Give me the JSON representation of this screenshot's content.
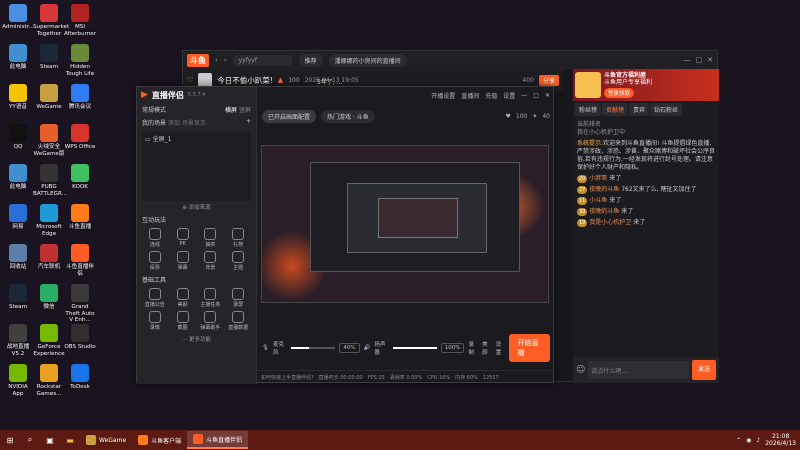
{
  "desktop": {
    "icons": [
      {
        "label": "Administr...",
        "color": "#4a90e2"
      },
      {
        "label": "Supermarket Together",
        "color": "#d9383a"
      },
      {
        "label": "MSI Afterburner",
        "color": "#b22222"
      },
      {
        "label": "此电脑",
        "color": "#3e8ed0"
      },
      {
        "label": "Steam",
        "color": "#1b2838"
      },
      {
        "label": "Hidden Tough Life",
        "color": "#6a8a3a"
      },
      {
        "label": "YY语音",
        "color": "#f5c400"
      },
      {
        "label": "WeGame",
        "color": "#c8a040"
      },
      {
        "label": "腾讯会议",
        "color": "#2f7cf6"
      },
      {
        "label": "QQ",
        "color": "#111111"
      },
      {
        "label": "火绒安全 WeGame版",
        "color": "#e65f2b"
      },
      {
        "label": "WPS Office",
        "color": "#d8342c"
      },
      {
        "label": "此电脑",
        "color": "#3e8ed0"
      },
      {
        "label": "PUBG BATTLEGR...",
        "color": "#333333"
      },
      {
        "label": "KOOK",
        "color": "#40c060"
      },
      {
        "label": "网易",
        "color": "#2a6fd8"
      },
      {
        "label": "Microsoft Edge",
        "color": "#1f9ad6"
      },
      {
        "label": "斗鱼直播",
        "color": "#ff7b1a"
      },
      {
        "label": "回收站",
        "color": "#5a7fa8"
      },
      {
        "label": "汽车联机",
        "color": "#c03030"
      },
      {
        "label": "斗鱼直播伴侣",
        "color": "#ff5d23"
      },
      {
        "label": "Steam",
        "color": "#1b2838"
      },
      {
        "label": "微信",
        "color": "#2aae67"
      },
      {
        "label": "Grand Theft Auto V Enh...",
        "color": "#3a3a3a"
      },
      {
        "label": "战地直播 V5.2",
        "color": "#404040"
      },
      {
        "label": "GeForce Experience",
        "color": "#76b900"
      },
      {
        "label": "OBS Studio",
        "color": "#302e31"
      },
      {
        "label": "NVIDIA App",
        "color": "#76b900"
      },
      {
        "label": "Rockstar Games...",
        "color": "#e8a020"
      },
      {
        "label": "ToDesk",
        "color": "#1a73e8"
      }
    ]
  },
  "client": {
    "logo": "斗鱼",
    "search_value": "yyfyyf",
    "tab1": "推荐",
    "tab2": "潘娜娜的小房间的直播间",
    "room_title": "今日不偷小趴菜!",
    "room_views": "100",
    "room_date": "2026-04-13 19:05",
    "follow_count": "400",
    "share_label": "分享",
    "promo_title": "斗鱼官方福利屋",
    "promo_sub": "斗鱼用户专享福利",
    "promo_btn": "登录领取",
    "rp_tabs": [
      "粉丝榜",
      "贡献榜",
      "贵宾",
      "钻石粉丝"
    ],
    "rp_active": "贡献榜",
    "rank_label": "当前排名",
    "rank_text": "我在小心机护卫中",
    "sys_label": "系统提示:",
    "sys_text": "欢迎来到斗鱼直播间! 斗鱼提倡绿色直播,严禁涉政、涉恐、涉黄、聚众赌博和破坏社会公序良俗,若有违规行为,一经发现将进行封号处理。请注意保护好个人财产和隐私。",
    "msgs": [
      {
        "lv": "20",
        "name": "小胖哥",
        "text": "来了"
      },
      {
        "lv": "27",
        "name": "夜晚的斗鱼",
        "text": "762又来了么, 瞎扯又加住了"
      },
      {
        "lv": "11",
        "name": "小斗鱼",
        "text": "来了"
      },
      {
        "lv": "30",
        "name": "夜晚的斗鱼",
        "text": "来了"
      },
      {
        "lv": "19",
        "name": "我是小心机护卫",
        "text": "来了"
      }
    ],
    "input_placeholder": "说点什么吧...",
    "send_label": "发送"
  },
  "live": {
    "logo": "直播伴侣",
    "version": "5.5.7.4",
    "mode": "常规模式",
    "mode_right1": "横屏",
    "mode_right2": "竖屏",
    "scene_label": "我的场景",
    "scene_tab2": "添加",
    "scene_tab3": "场景显示",
    "scene_item": "全屏_1",
    "add_source": "添加来源",
    "title_hint": "5年了, ...",
    "top_btns": [
      "开播设置",
      "直播间",
      "充值",
      "设置"
    ],
    "category": "已开启画面配置",
    "game": "热门游戏 · 斗鱼",
    "likes": "100",
    "gifts": "40",
    "interaction_label": "互动玩法",
    "interaction_tools": [
      "连线",
      "PK",
      "抽奖",
      "礼物",
      "投票",
      "弹幕",
      "背景",
      "主题"
    ],
    "basic_label": "基础工具",
    "basic_tools": [
      "直播公告",
      "美颜",
      "主播任务",
      "录屏",
      "录像",
      "截图",
      "弹幕助手",
      "直播数据"
    ],
    "more_tools": "更多功能",
    "mic_label": "麦克风",
    "mic_pct": "40%",
    "spk_label": "扬声器",
    "spk_pct": "100%",
    "mic_level": 0.4,
    "spk_level": 1.0,
    "btn_rec": "录制",
    "btn_beauty": "美颜",
    "btn_settings": "设置",
    "go_live": "开始直播",
    "status": [
      "如何快速上手直播伴侣?",
      "直播时长 00:00:00",
      "FPS 25",
      "丢帧率 0.00%",
      "CPU 16%",
      "内存 60%",
      "12557"
    ]
  },
  "taskbar": {
    "apps": [
      {
        "label": "WeGame",
        "color": "#c8a040",
        "active": false
      },
      {
        "label": "斗鱼客户端",
        "color": "#ff7b1a",
        "active": false
      },
      {
        "label": "斗鱼直播伴侣",
        "color": "#ff5d23",
        "active": true
      }
    ],
    "time": "21:08",
    "date": "2026/4/13"
  }
}
